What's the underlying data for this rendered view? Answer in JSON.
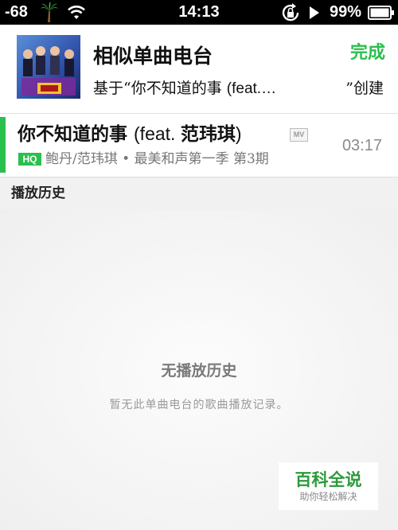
{
  "status_bar": {
    "signal": "-68",
    "time": "14:13",
    "battery": "99%",
    "icons": [
      "palm-tree-icon",
      "wifi-icon",
      "rotation-lock-icon",
      "play-icon",
      "battery-icon"
    ]
  },
  "header": {
    "title": "相似单曲电台",
    "done_label": "完成",
    "subtitle_prefix": "基于“你不知道的事 ",
    "subtitle_song": "(feat.…",
    "subtitle_suffix": "”创建"
  },
  "song": {
    "title_cn": "你不知道的事 ",
    "title_feat": "(feat. ",
    "title_feat_cn": "范玮琪",
    "title_close": ")",
    "mv_label": "MV",
    "hq_label": "HQ",
    "meta": "鲍丹/范玮琪 • 最美和声第一季 第3期",
    "duration": "03:17"
  },
  "section": {
    "title": "播放历史"
  },
  "empty": {
    "title": "无播放历史",
    "description": "暂无此单曲电台的歌曲播放记录。"
  },
  "watermark": {
    "main": "百科全说",
    "sub": "助你轻松解决"
  },
  "colors": {
    "accent": "#2bbf4e",
    "status_bar_bg": "#000000",
    "background": "#f3f3f3"
  }
}
